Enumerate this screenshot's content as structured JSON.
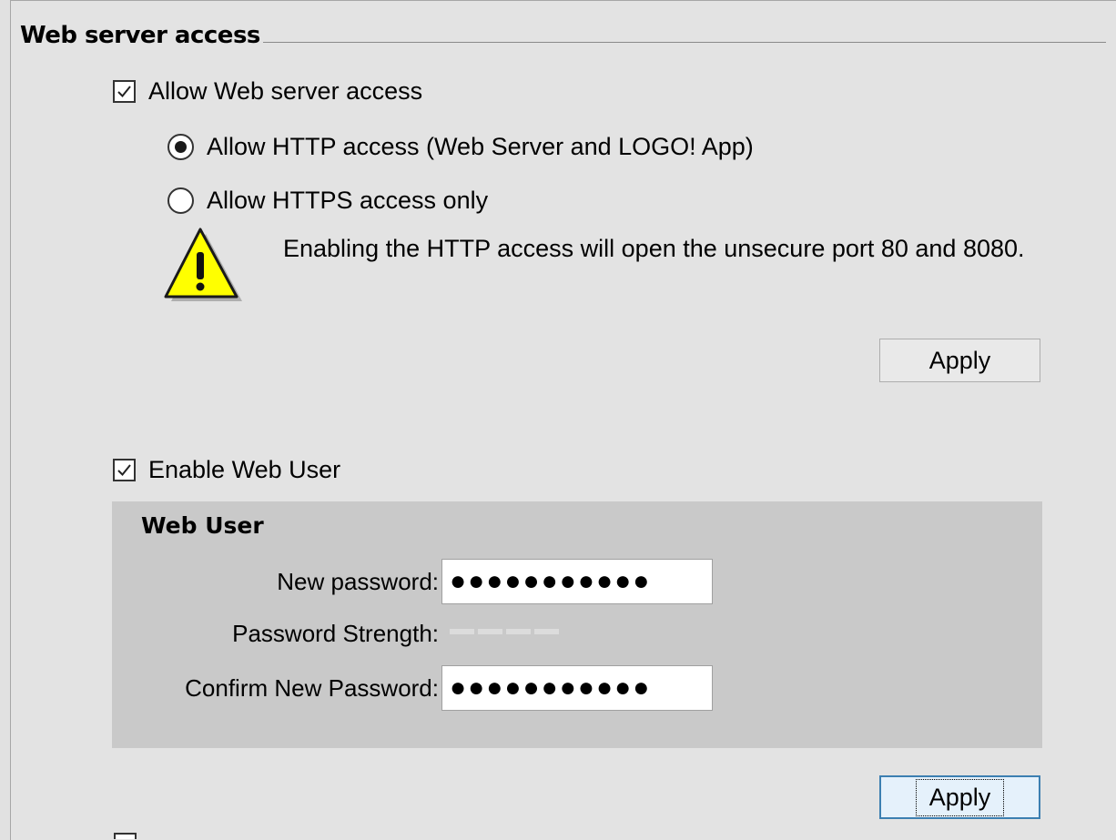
{
  "section": {
    "title": "Web server access"
  },
  "allow_access": {
    "label": "Allow Web server access",
    "checked": true
  },
  "access_mode": {
    "options": [
      {
        "label": "Allow HTTP access (Web Server and LOGO! App)",
        "selected": true
      },
      {
        "label": "Allow HTTPS access only",
        "selected": false
      }
    ]
  },
  "warning": {
    "icon": "warning-triangle-icon",
    "text": "Enabling the HTTP access will open the unsecure port 80 and 8080."
  },
  "apply_access": {
    "label": "Apply"
  },
  "enable_web_user": {
    "label": "Enable Web User",
    "checked": true
  },
  "web_user": {
    "title": "Web User",
    "new_password_label": "New password:",
    "new_password_value": "●●●●●●●●●●●",
    "strength_label": "Password Strength:",
    "strength_level": 0,
    "confirm_label": "Confirm New Password:",
    "confirm_value": "●●●●●●●●●●●"
  },
  "apply_user": {
    "label": "Apply"
  },
  "colors": {
    "panel_bg": "#e3e3e3",
    "group_bg": "#c9c9c9",
    "warning_yellow": "#ffff00",
    "default_button_border": "#3c7fb1"
  }
}
